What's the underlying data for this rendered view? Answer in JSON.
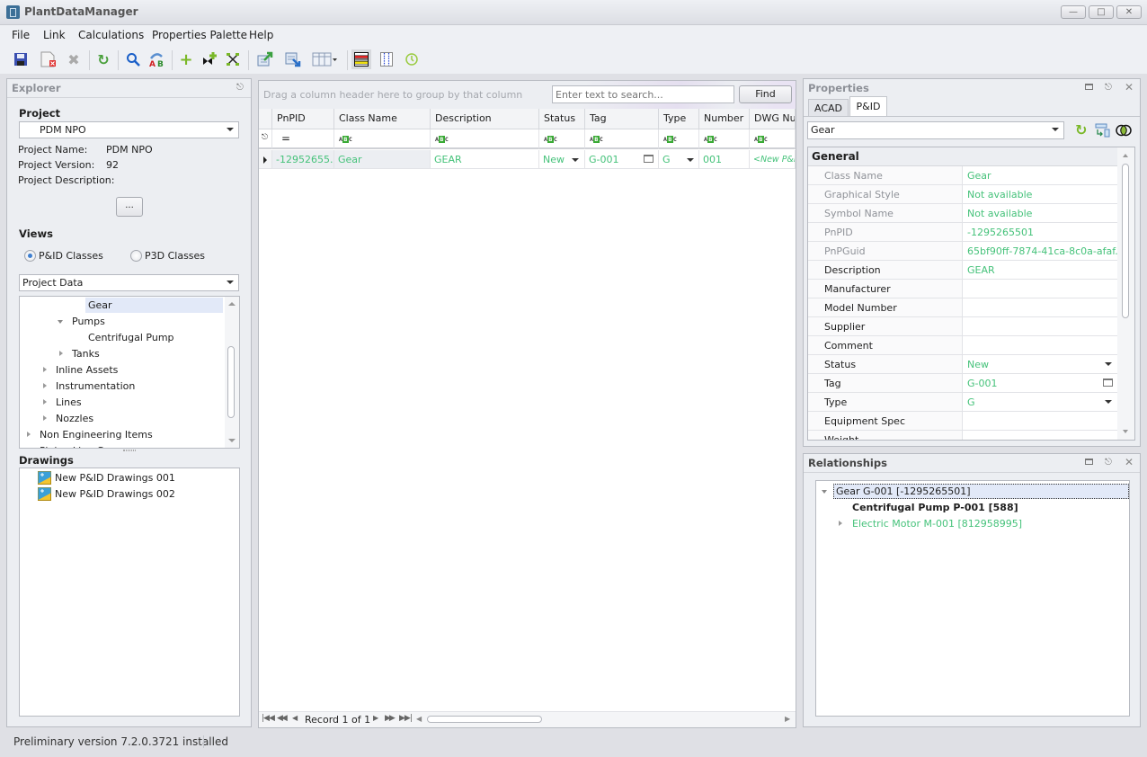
{
  "app": {
    "title": "PlantDataManager"
  },
  "window_controls": {
    "minimize": "minimize",
    "maximize": "maximize",
    "close": "close"
  },
  "menu": [
    "File",
    "Link",
    "Calculations",
    "Properties Palette",
    "Help"
  ],
  "toolbar": {
    "buttons": [
      {
        "name": "save",
        "icon": "save-icon"
      },
      {
        "name": "delete-document",
        "icon": "document-delete-icon"
      },
      {
        "name": "cancel",
        "icon": "x-icon"
      },
      {
        "name": "refresh",
        "icon": "refresh-icon"
      },
      {
        "name": "find",
        "icon": "search-icon"
      },
      {
        "name": "replace",
        "icon": "find-replace-icon"
      },
      {
        "name": "add",
        "icon": "plus-icon"
      },
      {
        "name": "add-connection",
        "icon": "add-connection-icon"
      },
      {
        "name": "split",
        "icon": "split-icon"
      },
      {
        "name": "export",
        "icon": "export-icon"
      },
      {
        "name": "import",
        "icon": "import-icon"
      },
      {
        "name": "layout",
        "icon": "table-layout-icon"
      },
      {
        "name": "row-colors",
        "icon": "row-colors-icon"
      },
      {
        "name": "columns",
        "icon": "columns-icon"
      },
      {
        "name": "history",
        "icon": "clock-icon"
      }
    ]
  },
  "explorer": {
    "title": "Explorer",
    "project_label": "Project",
    "project_selected": "PDM NPO",
    "project_name_label": "Project Name:",
    "project_name": "PDM NPO",
    "project_version_label": "Project Version:",
    "project_version": "92",
    "project_description_label": "Project Description:",
    "project_description": "",
    "more_button": "...",
    "views_label": "Views",
    "view_options": [
      {
        "label": "P&ID Classes",
        "selected": true
      },
      {
        "label": "P3D Classes",
        "selected": false
      }
    ],
    "data_selector": "Project Data",
    "tree": [
      {
        "label": "Gear",
        "level": 4,
        "expander": "none",
        "selected": true
      },
      {
        "label": "Pumps",
        "level": 3,
        "expander": "expanded"
      },
      {
        "label": "Centrifugal Pump",
        "level": 4,
        "expander": "none"
      },
      {
        "label": "Tanks",
        "level": 3,
        "expander": "collapsed"
      },
      {
        "label": "Inline Assets",
        "level": 2,
        "expander": "collapsed"
      },
      {
        "label": "Instrumentation",
        "level": 2,
        "expander": "collapsed"
      },
      {
        "label": "Lines",
        "level": 2,
        "expander": "collapsed"
      },
      {
        "label": "Nozzles",
        "level": 2,
        "expander": "collapsed"
      },
      {
        "label": "Non Engineering Items",
        "level": 1,
        "expander": "collapsed"
      },
      {
        "label": "Piping Line Groups",
        "level": 1,
        "expander": "collapsed"
      }
    ],
    "drawings_label": "Drawings",
    "drawings": [
      "New P&ID Drawings 001",
      "New P&ID Drawings 002"
    ]
  },
  "grid": {
    "group_hint": "Drag a column header here to group by that column",
    "search_placeholder": "Enter text to search...",
    "find_button": "Find",
    "columns": [
      "PnPID",
      "Class Name",
      "Description",
      "Status",
      "Tag",
      "Type",
      "Number",
      "DWG Num"
    ],
    "filter_row": [
      "=",
      "ABC",
      "ABC",
      "ABC",
      "ABC",
      "ABC",
      "ABC",
      "ABC"
    ],
    "rows": [
      {
        "PnPID": "-12952655...",
        "Class Name": "Gear",
        "Description": "GEAR",
        "Status": "New",
        "Tag": "G-001",
        "Type": "G",
        "Number": "001",
        "DWG Num": "<New P&ID"
      }
    ],
    "navigator": "Record 1 of 1"
  },
  "properties": {
    "title": "Properties",
    "tabs": [
      {
        "label": "ACAD",
        "active": false
      },
      {
        "label": "P&ID",
        "active": true
      }
    ],
    "object_selector": "Gear",
    "category": "General",
    "rows": [
      {
        "name": "Class Name",
        "value": "Gear",
        "readonly": true
      },
      {
        "name": "Graphical Style",
        "value": "Not available",
        "readonly": true
      },
      {
        "name": "Symbol Name",
        "value": "Not available",
        "readonly": true
      },
      {
        "name": "PnPID",
        "value": "-1295265501",
        "readonly": true
      },
      {
        "name": "PnPGuid",
        "value": "65bf90ff-7874-41ca-8c0a-afaf...",
        "readonly": true
      },
      {
        "name": "Description",
        "value": "GEAR",
        "readonly": false
      },
      {
        "name": "Manufacturer",
        "value": "",
        "readonly": false
      },
      {
        "name": "Model Number",
        "value": "",
        "readonly": false
      },
      {
        "name": "Supplier",
        "value": "",
        "readonly": false
      },
      {
        "name": "Comment",
        "value": "",
        "readonly": false
      },
      {
        "name": "Status",
        "value": "New",
        "readonly": false,
        "editor": "dropdown"
      },
      {
        "name": "Tag",
        "value": "G-001",
        "readonly": false,
        "editor": "button"
      },
      {
        "name": "Type",
        "value": "G",
        "readonly": false,
        "editor": "dropdown"
      },
      {
        "name": "Equipment Spec",
        "value": "",
        "readonly": false
      },
      {
        "name": "Weight",
        "value": "",
        "readonly": false
      }
    ]
  },
  "relationships": {
    "title": "Relationships",
    "root": "Gear G-001 [-1295265501]",
    "children": [
      {
        "label": "Centrifugal Pump P-001 [588]",
        "bold": true,
        "expander": "none"
      },
      {
        "label": "Electric Motor M-001 [812958995]",
        "bold": false,
        "expander": "collapsed"
      }
    ]
  },
  "status_bar": {
    "message": "Preliminary version 7.2.0.3721 installed"
  },
  "colors": {
    "value_green": "#45c27a",
    "accent_blue": "#3c6f97",
    "selection": "#e2e9f8"
  }
}
